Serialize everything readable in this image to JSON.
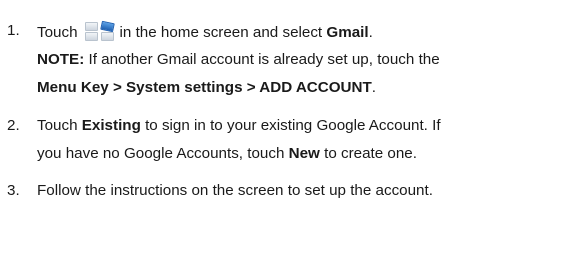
{
  "steps": [
    {
      "number": "1.",
      "pre": "Touch",
      "icon": "apps-grid-icon",
      "mid": "in the home screen and select",
      "bold": "Gmail",
      "end": "."
    },
    {
      "number": "2.",
      "l1_pre": "Touch",
      "l1_bold": "Existing",
      "l1_post": "to sign in to your existing Google Account. If",
      "l2_pre": "you have no Google Accounts, touch",
      "l2_bold": "New",
      "l2_post": "to create one."
    },
    {
      "number": "3.",
      "text": "Follow the instructions on the screen to set up the account."
    }
  ],
  "note": {
    "label": "NOTE:",
    "text": "If another Gmail account is already set up, touch the",
    "path": "Menu Key > System settings > ADD ACCOUNT",
    "end": "."
  }
}
